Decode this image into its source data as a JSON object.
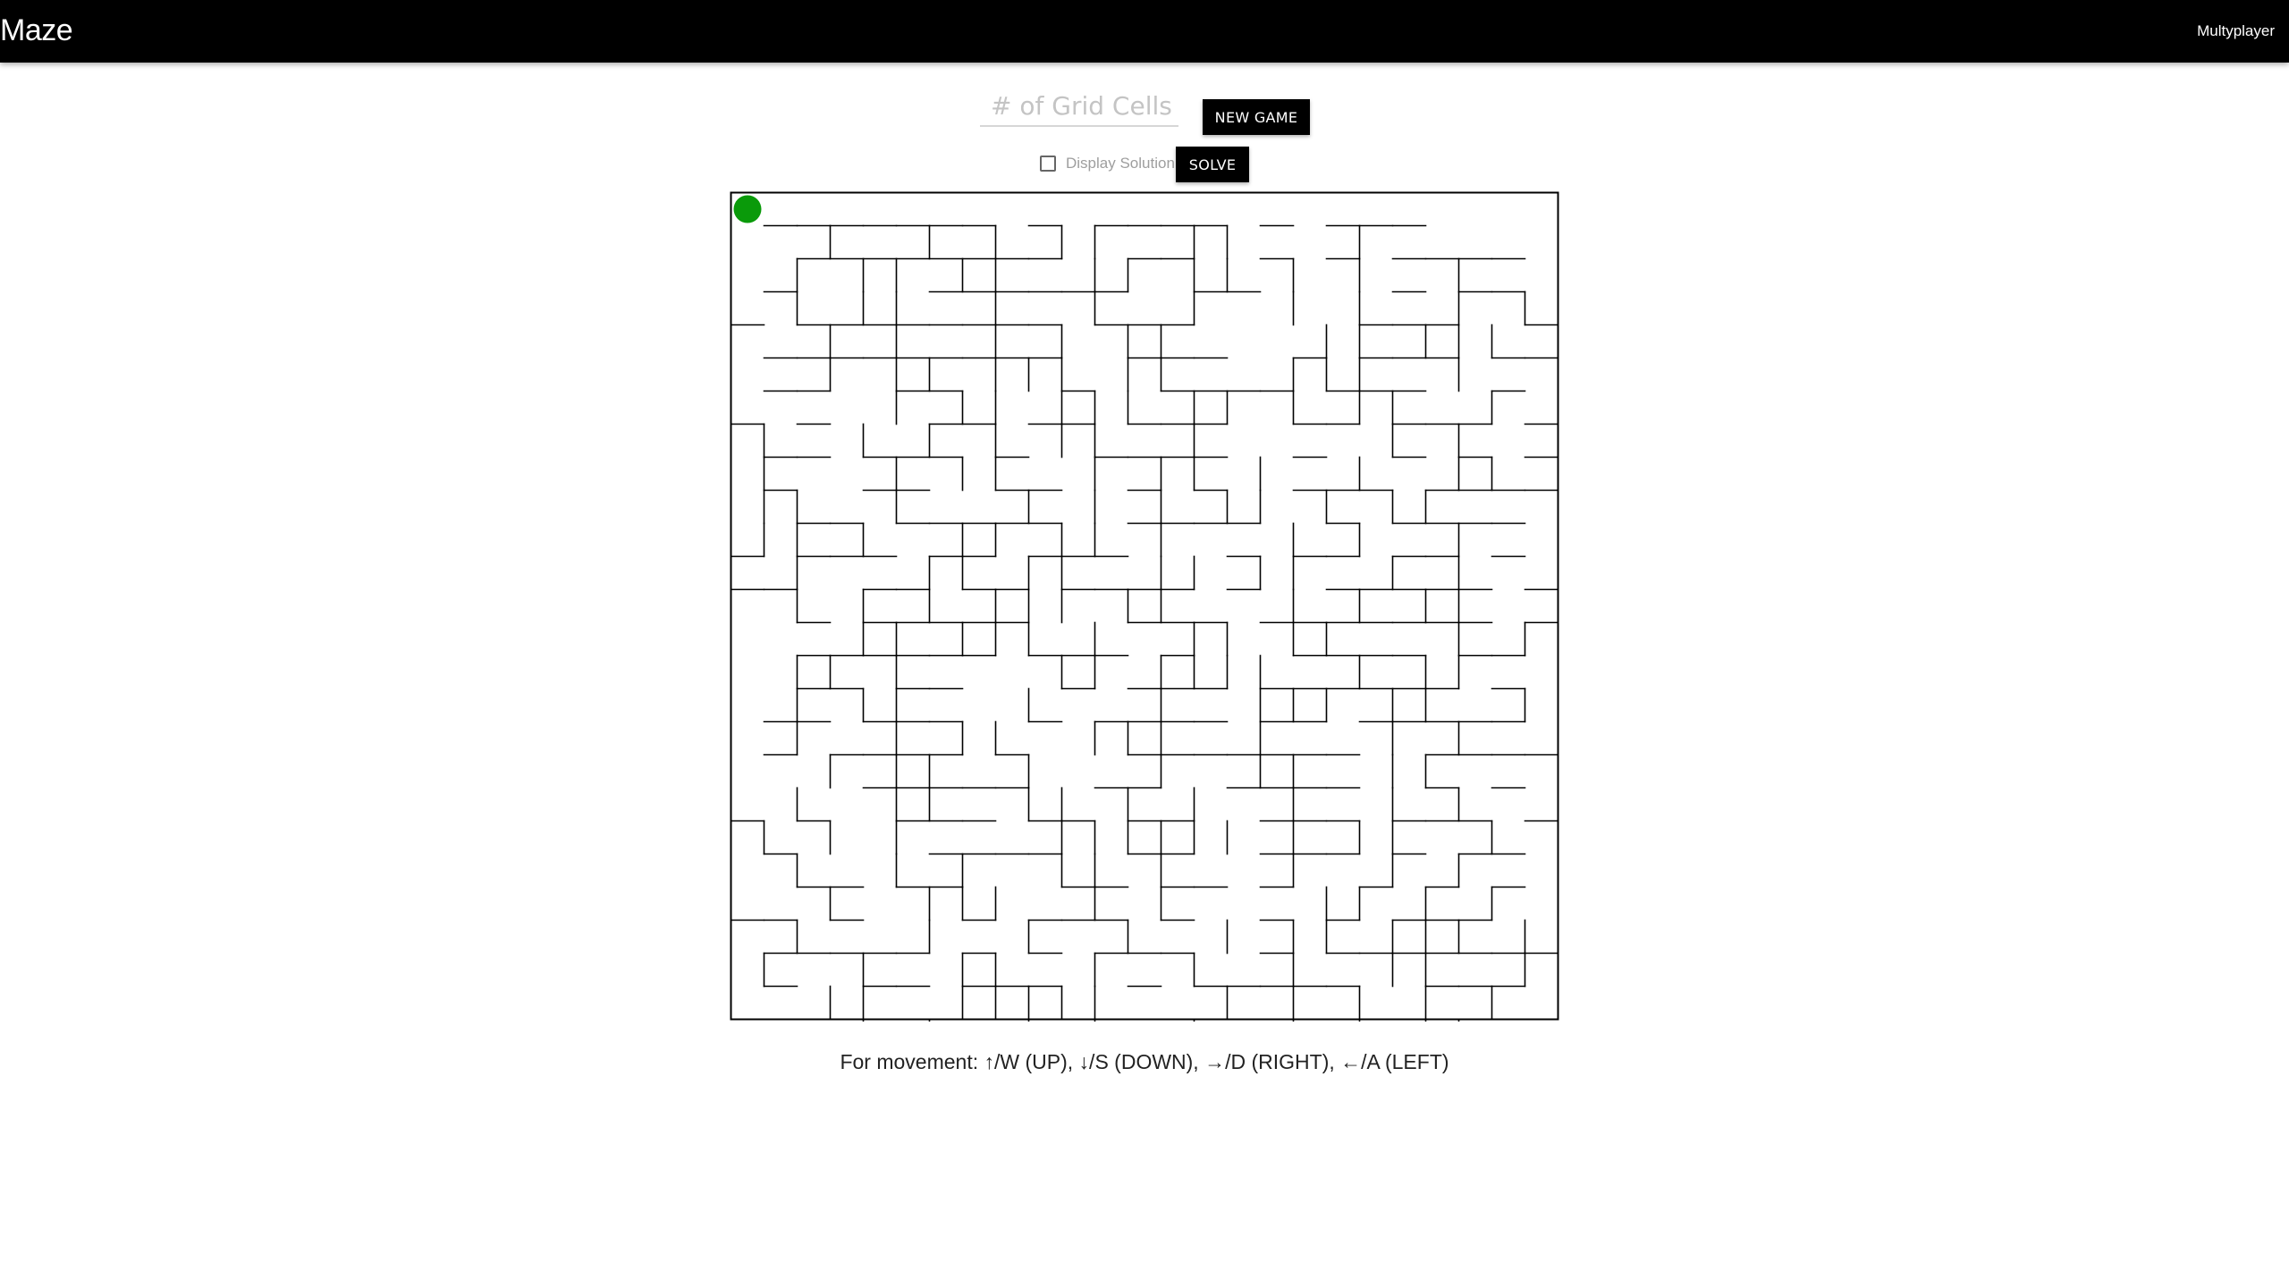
{
  "app": {
    "title": "Maze",
    "nav_multiplayer": "Multyplayer"
  },
  "controls": {
    "grid_cells_placeholder": "# of Grid Cells",
    "grid_cells_value": "",
    "new_game_label": "NEW GAME",
    "display_solution_label": "Display Solution",
    "display_solution_checked": false,
    "solve_label": "SOLVE"
  },
  "maze": {
    "columns": 25,
    "rows": 25,
    "player_color": "#0a9a0a",
    "wall_color": "#000000",
    "player": {
      "row": 0,
      "col": 0
    },
    "horizontal_walls": [
      "",
      " xxxxxxx x xxxx x xxx    ",
      "  xxxxxxxx  xx  x x xxxx ",
      " x    xxxxxx  xx    x xx ",
      "x xxxxxxxx xxx     xxx  x",
      " xxxxxxxxx  xxx  x xxx xx",
      " xx  xx   x  xxxx xxx  x ",
      "x x   xx xx xxx  xx xxx x",
      " xx xxx x  xxxx  x  x x x",
      " x  xx  xx  x x  xxx xxxx",
      "  xx xxxxx  xxxx  x xxxx ",
      "x xxx xx xxx   x xx xx x ",
      "xx  xx xx xxxx x  xxxxx x",
      "  x xxxxx   xxx xxxxxxx x",
      "  xxxxxx xxx x   xxxx xx ",
      "  xx xx   x xxx xxxxxx x ",
      " xx xxx  x xxxx xx xxxxx ",
      " x xxxx x   xxxxxxx  xxxx",
      "    xxxxx  xx  xxxx  x x ",
      "x x  xxx xx xx  xxx xxx x",
      " x    xxxx  xx  xxx x xx ",
      "  xx xx   xx xx x  x x x ",
      "xx x   x xxx x  x x xxx  ",
      " xxxxx x x xxx  x xxxxxxx",
      " x  xx xxx  x xxxxx  xxx ",
      ""
    ],
    "vertical_walls": [
      "",
      "  x  x x xx  xx   x    ",
      " x xx xx  xx xx x x  x ",
      " x xx  x  x  x  x x  x x",
      "  x x  x x xx    xx xxx ",
      "  x xx xxx xx   xxx  x  ",
      "    x xx xxx xx x xx  x ",
      "x  x x x xx  x     x x  ",
      "x   x xx  x xx x  x  xx ",
      "xx  x   x x x xx x xx   ",
      "xx x  xx xx x   x x  x  ",
      " x   xx xx  xx xx  x x  ",
      " x x x xxx xx   x x xx  ",
      "   xx xxx x  xx xx   x x",
      " xx x    xx xxxx  x xx  ",
      " x xx   x   x  xxx xx  x",
      " x  x xx  xxx  x   x x  ",
      "  x xx  x   x  xx  xx  ",
      " x  xx  xx x x  x  x x ",
      "x x x    xxxxxx x xx  x ",
      " x  x x  xx x   x  x x  ",
      "  x  xxx  x x    xx x x ",
      " x   x  x  x  x xx xxx x",
      "x  x  xx  x  x  x  xx  x",
      "  xx  xxxxx   x x x x x ",
      "   x x  x x  x  x x xx  "
    ]
  },
  "instructions": "For movement: ↑/W (UP), ↓/S (DOWN), →/D (RIGHT), ←/A (LEFT)"
}
